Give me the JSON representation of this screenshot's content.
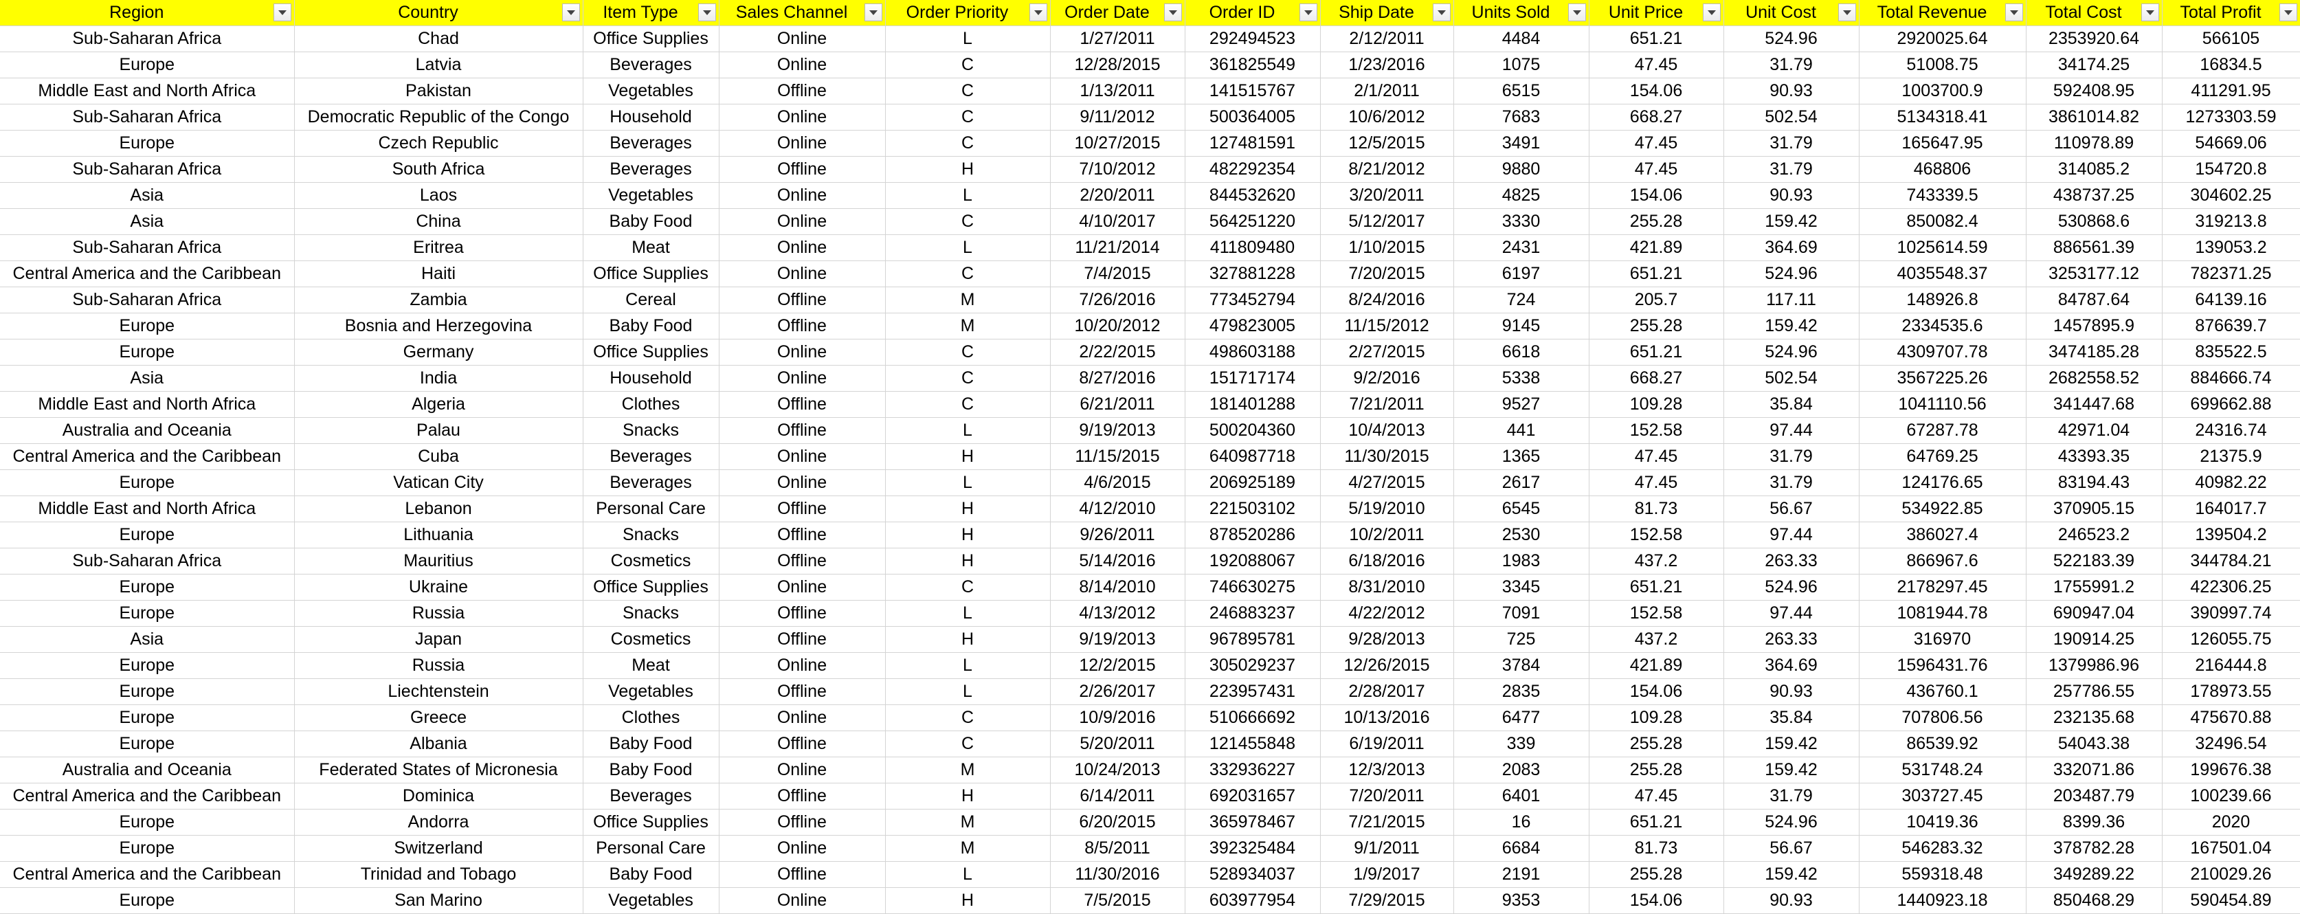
{
  "sheet": {
    "header_color": "#ffff00",
    "filter_icon": "filter-dropdown-icon",
    "columns": [
      "Region",
      "Country",
      "Item Type",
      "Sales Channel",
      "Order Priority",
      "Order Date",
      "Order ID",
      "Ship Date",
      "Units Sold",
      "Unit Price",
      "Unit Cost",
      "Total Revenue",
      "Total Cost",
      "Total Profit"
    ],
    "rows": [
      [
        "Sub-Saharan Africa",
        "Chad",
        "Office Supplies",
        "Online",
        "L",
        "1/27/2011",
        "292494523",
        "2/12/2011",
        "4484",
        "651.21",
        "524.96",
        "2920025.64",
        "2353920.64",
        "566105"
      ],
      [
        "Europe",
        "Latvia",
        "Beverages",
        "Online",
        "C",
        "12/28/2015",
        "361825549",
        "1/23/2016",
        "1075",
        "47.45",
        "31.79",
        "51008.75",
        "34174.25",
        "16834.5"
      ],
      [
        "Middle East and North Africa",
        "Pakistan",
        "Vegetables",
        "Offline",
        "C",
        "1/13/2011",
        "141515767",
        "2/1/2011",
        "6515",
        "154.06",
        "90.93",
        "1003700.9",
        "592408.95",
        "411291.95"
      ],
      [
        "Sub-Saharan Africa",
        "Democratic Republic of the Congo",
        "Household",
        "Online",
        "C",
        "9/11/2012",
        "500364005",
        "10/6/2012",
        "7683",
        "668.27",
        "502.54",
        "5134318.41",
        "3861014.82",
        "1273303.59"
      ],
      [
        "Europe",
        "Czech Republic",
        "Beverages",
        "Online",
        "C",
        "10/27/2015",
        "127481591",
        "12/5/2015",
        "3491",
        "47.45",
        "31.79",
        "165647.95",
        "110978.89",
        "54669.06"
      ],
      [
        "Sub-Saharan Africa",
        "South Africa",
        "Beverages",
        "Offline",
        "H",
        "7/10/2012",
        "482292354",
        "8/21/2012",
        "9880",
        "47.45",
        "31.79",
        "468806",
        "314085.2",
        "154720.8"
      ],
      [
        "Asia",
        "Laos",
        "Vegetables",
        "Online",
        "L",
        "2/20/2011",
        "844532620",
        "3/20/2011",
        "4825",
        "154.06",
        "90.93",
        "743339.5",
        "438737.25",
        "304602.25"
      ],
      [
        "Asia",
        "China",
        "Baby Food",
        "Online",
        "C",
        "4/10/2017",
        "564251220",
        "5/12/2017",
        "3330",
        "255.28",
        "159.42",
        "850082.4",
        "530868.6",
        "319213.8"
      ],
      [
        "Sub-Saharan Africa",
        "Eritrea",
        "Meat",
        "Online",
        "L",
        "11/21/2014",
        "411809480",
        "1/10/2015",
        "2431",
        "421.89",
        "364.69",
        "1025614.59",
        "886561.39",
        "139053.2"
      ],
      [
        "Central America and the Caribbean",
        "Haiti",
        "Office Supplies",
        "Online",
        "C",
        "7/4/2015",
        "327881228",
        "7/20/2015",
        "6197",
        "651.21",
        "524.96",
        "4035548.37",
        "3253177.12",
        "782371.25"
      ],
      [
        "Sub-Saharan Africa",
        "Zambia",
        "Cereal",
        "Offline",
        "M",
        "7/26/2016",
        "773452794",
        "8/24/2016",
        "724",
        "205.7",
        "117.11",
        "148926.8",
        "84787.64",
        "64139.16"
      ],
      [
        "Europe",
        "Bosnia and Herzegovina",
        "Baby Food",
        "Offline",
        "M",
        "10/20/2012",
        "479823005",
        "11/15/2012",
        "9145",
        "255.28",
        "159.42",
        "2334535.6",
        "1457895.9",
        "876639.7"
      ],
      [
        "Europe",
        "Germany",
        "Office Supplies",
        "Online",
        "C",
        "2/22/2015",
        "498603188",
        "2/27/2015",
        "6618",
        "651.21",
        "524.96",
        "4309707.78",
        "3474185.28",
        "835522.5"
      ],
      [
        "Asia",
        "India",
        "Household",
        "Online",
        "C",
        "8/27/2016",
        "151717174",
        "9/2/2016",
        "5338",
        "668.27",
        "502.54",
        "3567225.26",
        "2682558.52",
        "884666.74"
      ],
      [
        "Middle East and North Africa",
        "Algeria",
        "Clothes",
        "Offline",
        "C",
        "6/21/2011",
        "181401288",
        "7/21/2011",
        "9527",
        "109.28",
        "35.84",
        "1041110.56",
        "341447.68",
        "699662.88"
      ],
      [
        "Australia and Oceania",
        "Palau",
        "Snacks",
        "Offline",
        "L",
        "9/19/2013",
        "500204360",
        "10/4/2013",
        "441",
        "152.58",
        "97.44",
        "67287.78",
        "42971.04",
        "24316.74"
      ],
      [
        "Central America and the Caribbean",
        "Cuba",
        "Beverages",
        "Online",
        "H",
        "11/15/2015",
        "640987718",
        "11/30/2015",
        "1365",
        "47.45",
        "31.79",
        "64769.25",
        "43393.35",
        "21375.9"
      ],
      [
        "Europe",
        "Vatican City",
        "Beverages",
        "Online",
        "L",
        "4/6/2015",
        "206925189",
        "4/27/2015",
        "2617",
        "47.45",
        "31.79",
        "124176.65",
        "83194.43",
        "40982.22"
      ],
      [
        "Middle East and North Africa",
        "Lebanon",
        "Personal Care",
        "Offline",
        "H",
        "4/12/2010",
        "221503102",
        "5/19/2010",
        "6545",
        "81.73",
        "56.67",
        "534922.85",
        "370905.15",
        "164017.7"
      ],
      [
        "Europe",
        "Lithuania",
        "Snacks",
        "Offline",
        "H",
        "9/26/2011",
        "878520286",
        "10/2/2011",
        "2530",
        "152.58",
        "97.44",
        "386027.4",
        "246523.2",
        "139504.2"
      ],
      [
        "Sub-Saharan Africa",
        "Mauritius",
        "Cosmetics",
        "Offline",
        "H",
        "5/14/2016",
        "192088067",
        "6/18/2016",
        "1983",
        "437.2",
        "263.33",
        "866967.6",
        "522183.39",
        "344784.21"
      ],
      [
        "Europe",
        "Ukraine",
        "Office Supplies",
        "Online",
        "C",
        "8/14/2010",
        "746630275",
        "8/31/2010",
        "3345",
        "651.21",
        "524.96",
        "2178297.45",
        "1755991.2",
        "422306.25"
      ],
      [
        "Europe",
        "Russia",
        "Snacks",
        "Offline",
        "L",
        "4/13/2012",
        "246883237",
        "4/22/2012",
        "7091",
        "152.58",
        "97.44",
        "1081944.78",
        "690947.04",
        "390997.74"
      ],
      [
        "Asia",
        "Japan",
        "Cosmetics",
        "Offline",
        "H",
        "9/19/2013",
        "967895781",
        "9/28/2013",
        "725",
        "437.2",
        "263.33",
        "316970",
        "190914.25",
        "126055.75"
      ],
      [
        "Europe",
        "Russia",
        "Meat",
        "Online",
        "L",
        "12/2/2015",
        "305029237",
        "12/26/2015",
        "3784",
        "421.89",
        "364.69",
        "1596431.76",
        "1379986.96",
        "216444.8"
      ],
      [
        "Europe",
        "Liechtenstein",
        "Vegetables",
        "Offline",
        "L",
        "2/26/2017",
        "223957431",
        "2/28/2017",
        "2835",
        "154.06",
        "90.93",
        "436760.1",
        "257786.55",
        "178973.55"
      ],
      [
        "Europe",
        "Greece",
        "Clothes",
        "Online",
        "C",
        "10/9/2016",
        "510666692",
        "10/13/2016",
        "6477",
        "109.28",
        "35.84",
        "707806.56",
        "232135.68",
        "475670.88"
      ],
      [
        "Europe",
        "Albania",
        "Baby Food",
        "Offline",
        "C",
        "5/20/2011",
        "121455848",
        "6/19/2011",
        "339",
        "255.28",
        "159.42",
        "86539.92",
        "54043.38",
        "32496.54"
      ],
      [
        "Australia and Oceania",
        "Federated States of Micronesia",
        "Baby Food",
        "Online",
        "M",
        "10/24/2013",
        "332936227",
        "12/3/2013",
        "2083",
        "255.28",
        "159.42",
        "531748.24",
        "332071.86",
        "199676.38"
      ],
      [
        "Central America and the Caribbean",
        "Dominica",
        "Beverages",
        "Offline",
        "H",
        "6/14/2011",
        "692031657",
        "7/20/2011",
        "6401",
        "47.45",
        "31.79",
        "303727.45",
        "203487.79",
        "100239.66"
      ],
      [
        "Europe",
        "Andorra",
        "Office Supplies",
        "Offline",
        "M",
        "6/20/2015",
        "365978467",
        "7/21/2015",
        "16",
        "651.21",
        "524.96",
        "10419.36",
        "8399.36",
        "2020"
      ],
      [
        "Europe",
        "Switzerland",
        "Personal Care",
        "Online",
        "M",
        "8/5/2011",
        "392325484",
        "9/1/2011",
        "6684",
        "81.73",
        "56.67",
        "546283.32",
        "378782.28",
        "167501.04"
      ],
      [
        "Central America and the Caribbean",
        "Trinidad and Tobago",
        "Baby Food",
        "Offline",
        "L",
        "11/30/2016",
        "528934037",
        "1/9/2017",
        "2191",
        "255.28",
        "159.42",
        "559318.48",
        "349289.22",
        "210029.26"
      ],
      [
        "Europe",
        "San Marino",
        "Vegetables",
        "Online",
        "H",
        "7/5/2015",
        "603977954",
        "7/29/2015",
        "9353",
        "154.06",
        "90.93",
        "1440923.18",
        "850468.29",
        "590454.89"
      ]
    ]
  }
}
